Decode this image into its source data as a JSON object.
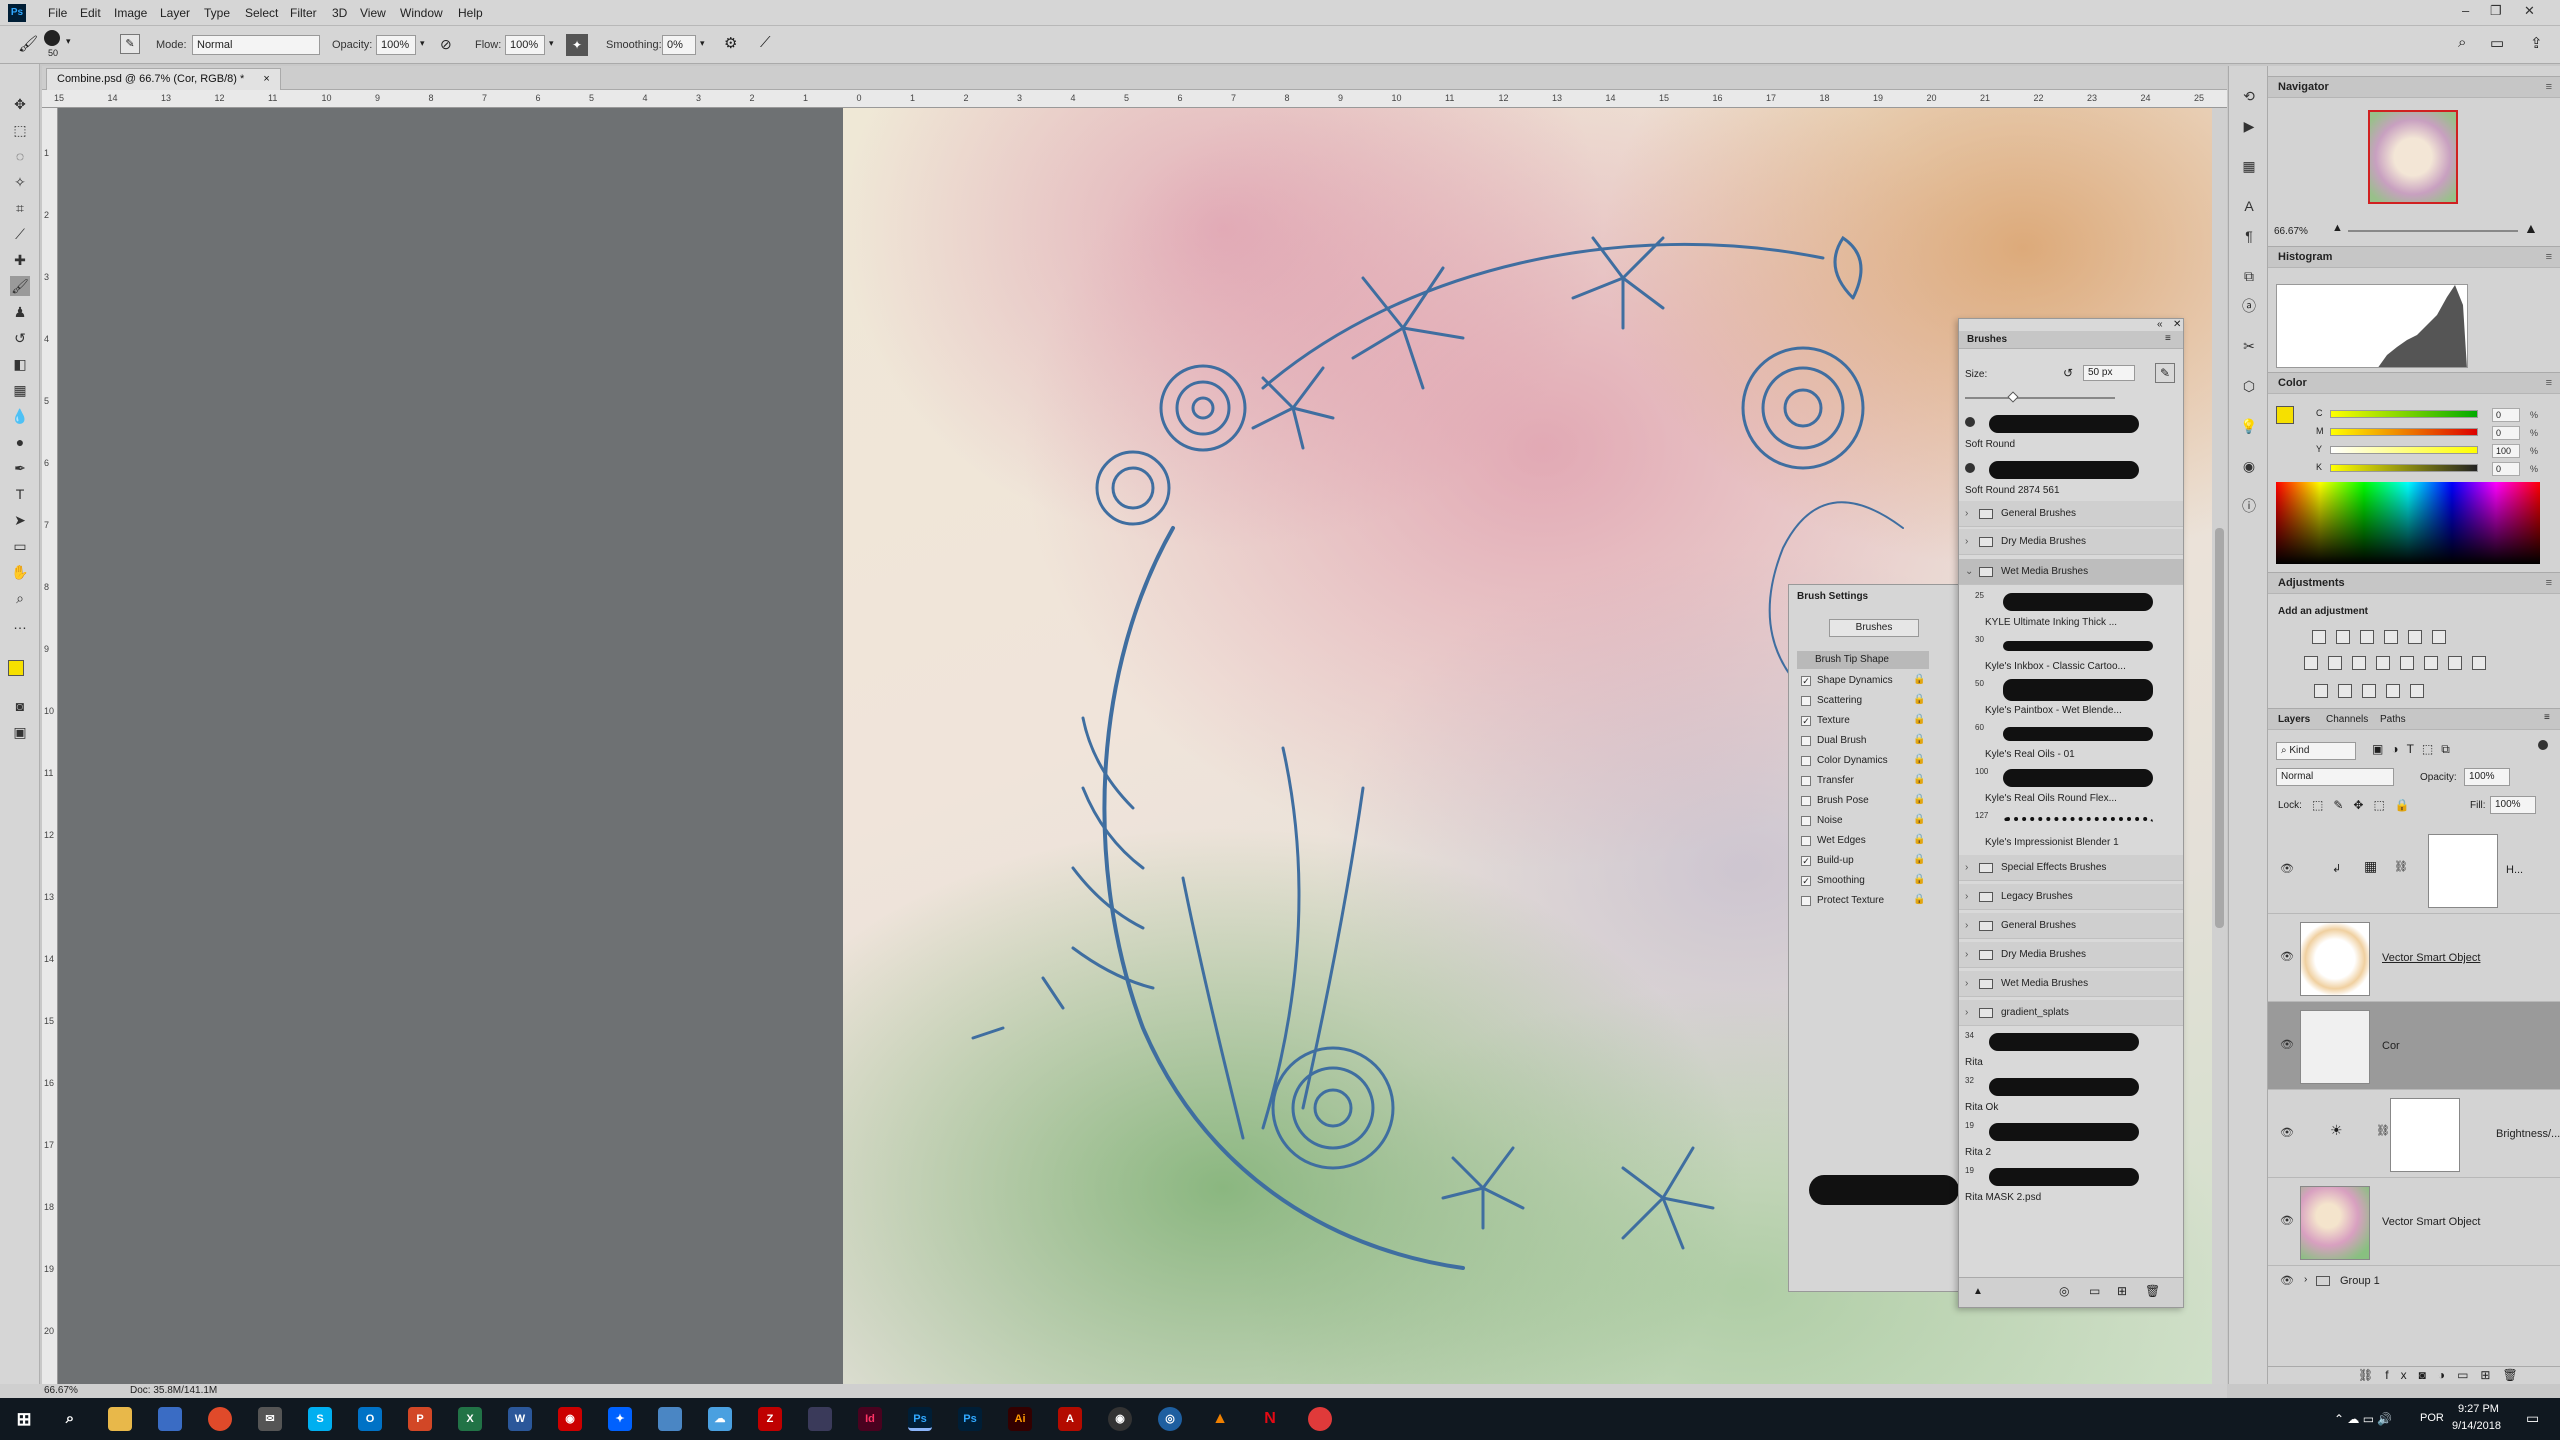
{
  "menubar": {
    "items": [
      "File",
      "Edit",
      "Image",
      "Layer",
      "Type",
      "Select",
      "Filter",
      "3D",
      "View",
      "Window",
      "Help"
    ]
  },
  "options": {
    "brush_size": "50",
    "mode_label": "Mode:",
    "mode_value": "Normal",
    "opacity_label": "Opacity:",
    "opacity_value": "100%",
    "flow_label": "Flow:",
    "flow_value": "100%",
    "smoothing_label": "Smoothing:",
    "smoothing_value": "0%"
  },
  "document": {
    "tab_title": "Combine.psd @ 66.7% (Cor, RGB/8) *",
    "close": "×"
  },
  "rulers": {
    "h": [
      "15",
      "14",
      "13",
      "12",
      "11",
      "10",
      "9",
      "8",
      "7",
      "6",
      "5",
      "4",
      "3",
      "2",
      "1",
      "0",
      "1",
      "2",
      "3",
      "4",
      "5",
      "6",
      "7",
      "8",
      "9",
      "10",
      "11",
      "12",
      "13",
      "14",
      "15",
      "16",
      "17",
      "18",
      "19",
      "20",
      "21",
      "22",
      "23",
      "24",
      "25"
    ],
    "v": [
      "1",
      "2",
      "3",
      "4",
      "5",
      "6",
      "7",
      "8",
      "9",
      "10",
      "11",
      "12",
      "13",
      "14",
      "15",
      "16",
      "17",
      "18",
      "19",
      "20"
    ]
  },
  "status": {
    "zoom": "66.67%",
    "doc": "Doc: 35.8M/141.1M"
  },
  "navigator": {
    "title": "Navigator",
    "zoom": "66.67%"
  },
  "histogram": {
    "title": "Histogram"
  },
  "color": {
    "title": "Color",
    "channels": [
      {
        "name": "C",
        "value": "0",
        "unit": "%"
      },
      {
        "name": "M",
        "value": "0",
        "unit": "%"
      },
      {
        "name": "Y",
        "value": "100",
        "unit": "%"
      },
      {
        "name": "K",
        "value": "0",
        "unit": "%"
      }
    ],
    "foreground": "#f6e000"
  },
  "adjustments": {
    "title": "Adjustments",
    "subtitle": "Add an adjustment"
  },
  "layers": {
    "tabs": [
      "Layers",
      "Channels",
      "Paths"
    ],
    "kind": "Kind",
    "blend": "Normal",
    "opacity_label": "Opacity:",
    "opacity_value": "100%",
    "lock_label": "Lock:",
    "fill_label": "Fill:",
    "fill_value": "100%",
    "rows": [
      {
        "name": "H..."
      },
      {
        "name": "Vector Smart Object"
      },
      {
        "name": "Cor"
      },
      {
        "name": "Brightness/..."
      },
      {
        "name": "Vector Smart Object"
      }
    ],
    "group": "Group 1"
  },
  "brush_settings": {
    "title": "Brush Settings",
    "brushes_button": "Brushes",
    "tip_shape": "Brush Tip Shape",
    "options": [
      {
        "label": "Shape Dynamics",
        "checked": true
      },
      {
        "label": "Scattering",
        "checked": false
      },
      {
        "label": "Texture",
        "checked": true
      },
      {
        "label": "Dual Brush",
        "checked": false
      },
      {
        "label": "Color Dynamics",
        "checked": false
      },
      {
        "label": "Transfer",
        "checked": false
      },
      {
        "label": "Brush Pose",
        "checked": false
      },
      {
        "label": "Noise",
        "checked": false
      },
      {
        "label": "Wet Edges",
        "checked": false
      },
      {
        "label": "Build-up",
        "checked": true
      },
      {
        "label": "Smoothing",
        "checked": true
      },
      {
        "label": "Protect Texture",
        "checked": false
      }
    ]
  },
  "brushes": {
    "title": "Brushes",
    "size_label": "Size:",
    "size_value": "50 px",
    "recent": [
      {
        "name": "Soft Round"
      },
      {
        "name": "Soft Round 2874 561"
      }
    ],
    "groups_top": [
      "General Brushes",
      "Dry Media Brushes",
      "Wet Media Brushes"
    ],
    "wet_items": [
      {
        "size": "25",
        "name": "KYLE Ultimate Inking Thick ..."
      },
      {
        "size": "30",
        "name": "Kyle's Inkbox - Classic Cartoo..."
      },
      {
        "size": "50",
        "name": "Kyle's Paintbox - Wet Blende..."
      },
      {
        "size": "60",
        "name": "Kyle's Real Oils - 01"
      },
      {
        "size": "100",
        "name": "Kyle's Real Oils Round Flex..."
      },
      {
        "size": "127",
        "name": "Kyle's Impressionist Blender 1"
      }
    ],
    "groups_bottom": [
      "Special Effects Brushes",
      "Legacy Brushes",
      "General Brushes",
      "Dry Media Brushes",
      "Wet Media Brushes",
      "gradient_splats"
    ],
    "custom": [
      {
        "size": "34",
        "name": "Rita"
      },
      {
        "size": "32",
        "name": "Rita Ok"
      },
      {
        "size": "19",
        "name": "Rita 2"
      },
      {
        "size": "19",
        "name": "Rita MASK 2.psd"
      }
    ]
  },
  "taskbar": {
    "time": "9:27 PM",
    "date": "9/14/2018",
    "lang": "POR"
  }
}
